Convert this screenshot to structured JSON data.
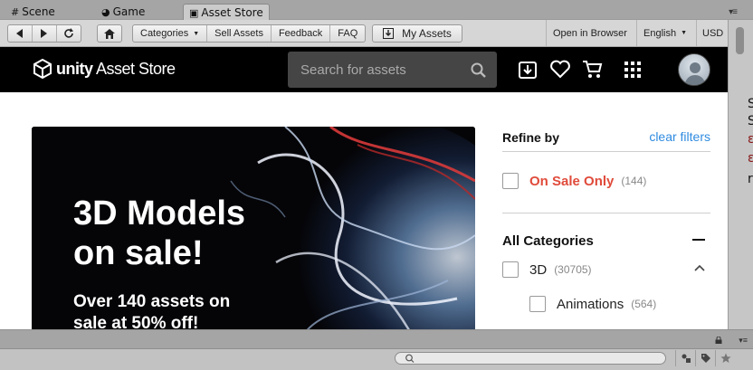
{
  "editor_tabs": [
    {
      "label": "Scene",
      "icon": "grid-icon"
    },
    {
      "label": "Game",
      "icon": "pacman-icon"
    },
    {
      "label": "Asset Store",
      "icon": "store-bag-icon"
    }
  ],
  "toolbar": {
    "categories": "Categories",
    "sell_assets": "Sell Assets",
    "feedback": "Feedback",
    "faq": "FAQ",
    "my_assets": "My Assets",
    "open_in_browser": "Open in Browser",
    "language": "English",
    "currency": "USD"
  },
  "store": {
    "logo_bold": "unity",
    "logo_rest": " Asset Store",
    "search_placeholder": "Search for assets"
  },
  "hero": {
    "title": "3D Models on sale!",
    "subtitle": "Over 140 assets on sale at 50% off!"
  },
  "filters": {
    "refine_by": "Refine by",
    "clear_filters": "clear filters",
    "on_sale_label": "On Sale Only",
    "on_sale_count": "(144)",
    "all_categories": "All Categories",
    "categories": [
      {
        "label": "3D",
        "count": "(30705)"
      },
      {
        "label": "Animations",
        "count": "(564)"
      }
    ]
  },
  "scrollbar_edge_glyphs": [
    "S",
    "S",
    "ε",
    "ε",
    "r"
  ],
  "colors": {
    "accent_link": "#2f8be0",
    "sale_red": "#e04b3b",
    "store_header": "#000000"
  }
}
